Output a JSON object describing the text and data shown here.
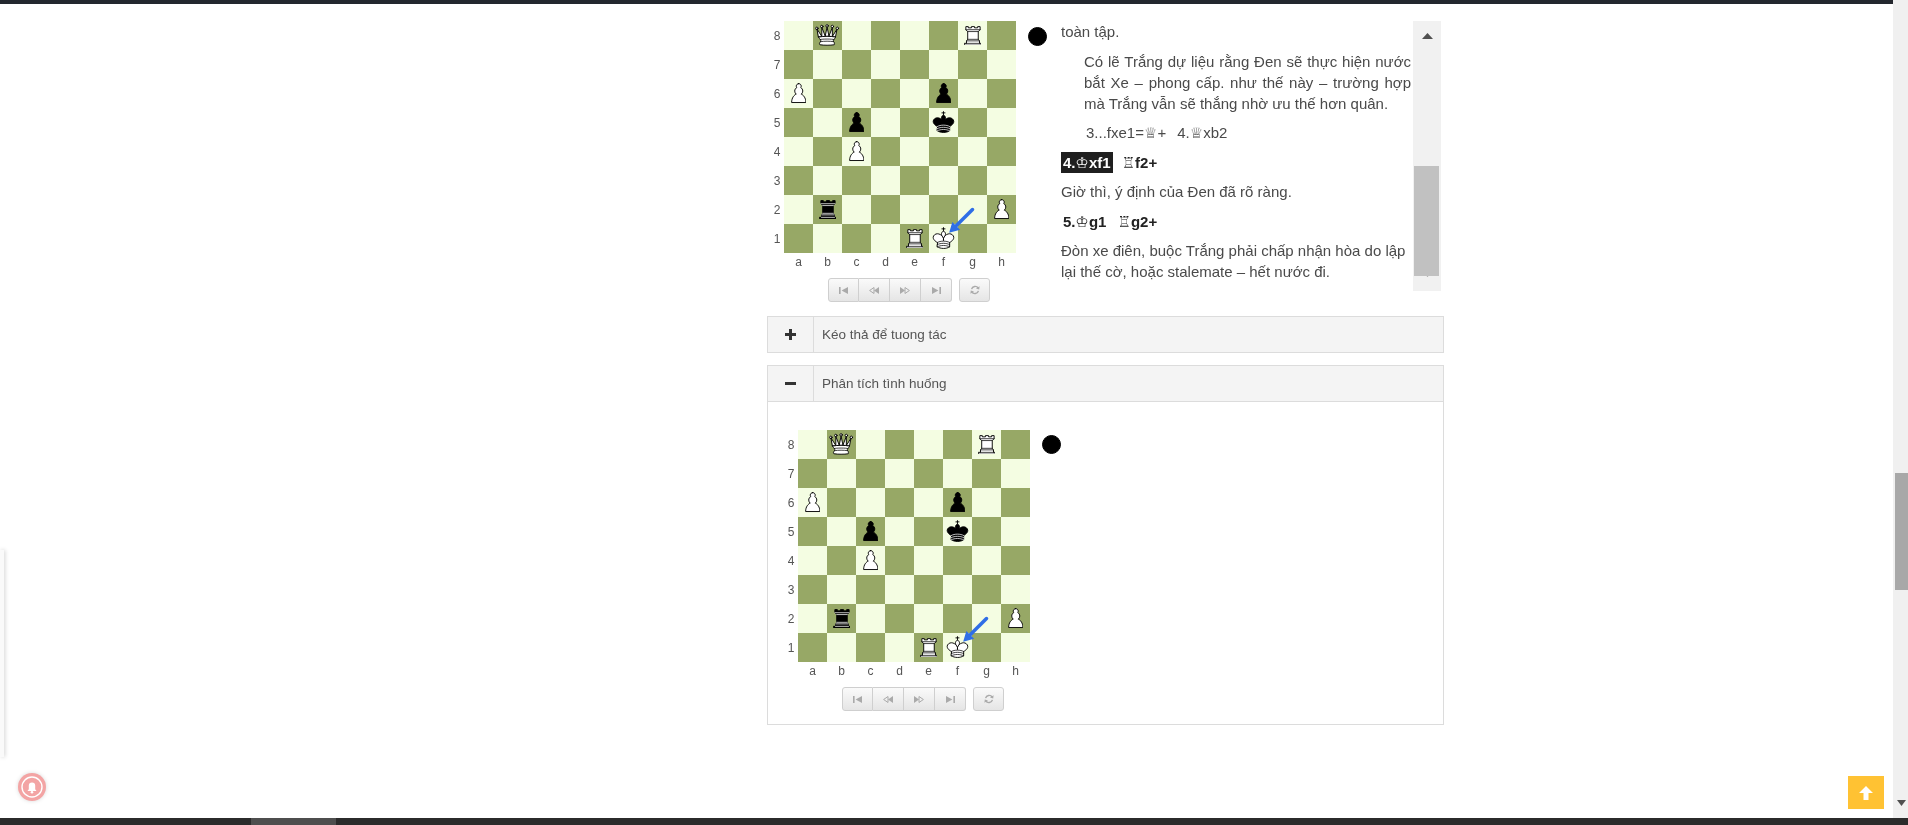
{
  "study": {
    "board": {
      "rows": [
        {
          "label": "8",
          "squares": [
            {
              "kind": "empty"
            },
            {
              "kind": "white_queen"
            },
            {
              "kind": "empty"
            },
            {
              "kind": "empty"
            },
            {
              "kind": "empty"
            },
            {
              "kind": "empty"
            },
            {
              "kind": "white_rook"
            },
            {
              "kind": "empty"
            }
          ]
        },
        {
          "label": "7",
          "squares": [
            {
              "kind": "empty"
            },
            {
              "kind": "empty"
            },
            {
              "kind": "empty"
            },
            {
              "kind": "empty"
            },
            {
              "kind": "empty"
            },
            {
              "kind": "empty"
            },
            {
              "kind": "empty"
            },
            {
              "kind": "empty"
            }
          ]
        },
        {
          "label": "6",
          "squares": [
            {
              "kind": "white_pawn"
            },
            {
              "kind": "empty"
            },
            {
              "kind": "empty"
            },
            {
              "kind": "empty"
            },
            {
              "kind": "empty"
            },
            {
              "kind": "black_pawn"
            },
            {
              "kind": "empty"
            },
            {
              "kind": "empty"
            }
          ]
        },
        {
          "label": "5",
          "squares": [
            {
              "kind": "empty"
            },
            {
              "kind": "empty"
            },
            {
              "kind": "black_pawn"
            },
            {
              "kind": "empty"
            },
            {
              "kind": "empty"
            },
            {
              "kind": "black_king"
            },
            {
              "kind": "empty"
            },
            {
              "kind": "empty"
            }
          ]
        },
        {
          "label": "4",
          "squares": [
            {
              "kind": "empty"
            },
            {
              "kind": "empty"
            },
            {
              "kind": "white_pawn"
            },
            {
              "kind": "empty"
            },
            {
              "kind": "empty"
            },
            {
              "kind": "empty"
            },
            {
              "kind": "empty"
            },
            {
              "kind": "empty"
            }
          ]
        },
        {
          "label": "3",
          "squares": [
            {
              "kind": "empty"
            },
            {
              "kind": "empty"
            },
            {
              "kind": "empty"
            },
            {
              "kind": "empty"
            },
            {
              "kind": "empty"
            },
            {
              "kind": "empty"
            },
            {
              "kind": "empty"
            },
            {
              "kind": "empty"
            }
          ]
        },
        {
          "label": "2",
          "squares": [
            {
              "kind": "empty"
            },
            {
              "kind": "black_rook"
            },
            {
              "kind": "empty"
            },
            {
              "kind": "empty"
            },
            {
              "kind": "empty"
            },
            {
              "kind": "empty"
            },
            {
              "kind": "empty",
              "arrow_tail": true
            },
            {
              "kind": "white_pawn"
            }
          ]
        },
        {
          "label": "1",
          "squares": [
            {
              "kind": "empty"
            },
            {
              "kind": "empty"
            },
            {
              "kind": "empty"
            },
            {
              "kind": "empty"
            },
            {
              "kind": "white_rook"
            },
            {
              "kind": "white_king",
              "arrow_head": true
            },
            {
              "kind": "empty"
            },
            {
              "kind": "empty"
            }
          ]
        }
      ],
      "files": [
        "a",
        "b",
        "c",
        "d",
        "e",
        "f",
        "g",
        "h"
      ]
    },
    "black_to_move": true,
    "notation": [
      {
        "kind": "comment",
        "text": "toàn tập."
      },
      {
        "kind": "variation_comment",
        "text": "Có lẽ Trắng dự liệu rằng Đen sẽ thực hiện nước bắt Xe – phong cấp. như thế này – trường hợp mà Trắng vẫn sẽ thắng nhờ ưu thế hơn quân."
      },
      {
        "kind": "variation_moves",
        "moves": [
          {
            "text": "3...fxe1=♕+",
            "selected": false
          },
          {
            "text": "4.♕xb2",
            "selected": false
          }
        ]
      },
      {
        "kind": "main_moves",
        "moves": [
          {
            "text": "4.♔xf1",
            "selected": true
          },
          {
            "text": "♖f2+",
            "selected": false
          }
        ]
      },
      {
        "kind": "comment",
        "text": "Giờ thì, ý định của Đen đã rõ ràng."
      },
      {
        "kind": "main_moves",
        "moves": [
          {
            "text": "5.♔g1",
            "selected": false
          },
          {
            "text": "♖g2+",
            "selected": false
          }
        ]
      },
      {
        "kind": "comment",
        "text": "Đòn xe điên, buộc Trắng phải chấp nhận hòa do lập lại thế cờ, hoặc stalemate – hết nước đi."
      }
    ]
  },
  "panels": [
    {
      "title": "Kéo thả để tuong tác",
      "expanded": false
    },
    {
      "title": "Phân tích tình huống",
      "expanded": true,
      "board": {
        "rows": [
          {
            "label": "8",
            "squares": [
              {
                "kind": "empty"
              },
              {
                "kind": "white_queen"
              },
              {
                "kind": "empty"
              },
              {
                "kind": "empty"
              },
              {
                "kind": "empty"
              },
              {
                "kind": "empty"
              },
              {
                "kind": "white_rook"
              },
              {
                "kind": "empty"
              }
            ]
          },
          {
            "label": "7",
            "squares": [
              {
                "kind": "empty"
              },
              {
                "kind": "empty"
              },
              {
                "kind": "empty"
              },
              {
                "kind": "empty"
              },
              {
                "kind": "empty"
              },
              {
                "kind": "empty"
              },
              {
                "kind": "empty"
              },
              {
                "kind": "empty"
              }
            ]
          },
          {
            "label": "6",
            "squares": [
              {
                "kind": "white_pawn"
              },
              {
                "kind": "empty"
              },
              {
                "kind": "empty"
              },
              {
                "kind": "empty"
              },
              {
                "kind": "empty"
              },
              {
                "kind": "black_pawn"
              },
              {
                "kind": "empty"
              },
              {
                "kind": "empty"
              }
            ]
          },
          {
            "label": "5",
            "squares": [
              {
                "kind": "empty"
              },
              {
                "kind": "empty"
              },
              {
                "kind": "black_pawn"
              },
              {
                "kind": "empty"
              },
              {
                "kind": "empty"
              },
              {
                "kind": "black_king"
              },
              {
                "kind": "empty"
              },
              {
                "kind": "empty"
              }
            ]
          },
          {
            "label": "4",
            "squares": [
              {
                "kind": "empty"
              },
              {
                "kind": "empty"
              },
              {
                "kind": "white_pawn"
              },
              {
                "kind": "empty"
              },
              {
                "kind": "empty"
              },
              {
                "kind": "empty"
              },
              {
                "kind": "empty"
              },
              {
                "kind": "empty"
              }
            ]
          },
          {
            "label": "3",
            "squares": [
              {
                "kind": "empty"
              },
              {
                "kind": "empty"
              },
              {
                "kind": "empty"
              },
              {
                "kind": "empty"
              },
              {
                "kind": "empty"
              },
              {
                "kind": "empty"
              },
              {
                "kind": "empty"
              },
              {
                "kind": "empty"
              }
            ]
          },
          {
            "label": "2",
            "squares": [
              {
                "kind": "empty"
              },
              {
                "kind": "black_rook"
              },
              {
                "kind": "empty"
              },
              {
                "kind": "empty"
              },
              {
                "kind": "empty"
              },
              {
                "kind": "empty"
              },
              {
                "kind": "empty",
                "arrow_tail": true
              },
              {
                "kind": "white_pawn"
              }
            ]
          },
          {
            "label": "1",
            "squares": [
              {
                "kind": "empty"
              },
              {
                "kind": "empty"
              },
              {
                "kind": "empty"
              },
              {
                "kind": "empty"
              },
              {
                "kind": "white_rook"
              },
              {
                "kind": "white_king",
                "arrow_head": true
              },
              {
                "kind": "empty"
              },
              {
                "kind": "empty"
              }
            ]
          }
        ],
        "files": [
          "a",
          "b",
          "c",
          "d",
          "e",
          "f",
          "g",
          "h"
        ]
      },
      "black_to_move": true
    }
  ]
}
